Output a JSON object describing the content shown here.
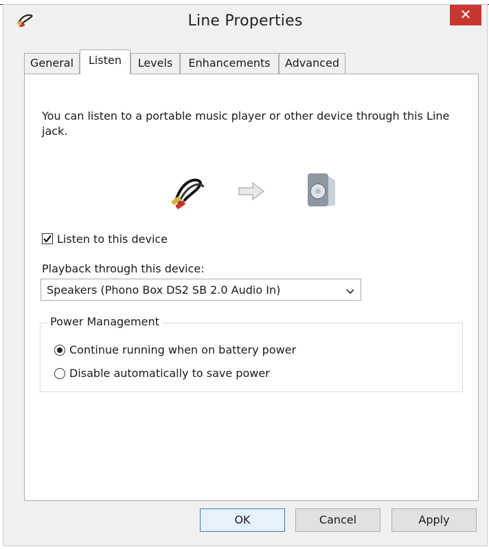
{
  "window": {
    "title": "Line Properties",
    "close_glyph": "✕",
    "icon": "line-in-cable-icon"
  },
  "tabs": [
    {
      "label": "General",
      "active": false
    },
    {
      "label": "Listen",
      "active": true
    },
    {
      "label": "Levels",
      "active": false
    },
    {
      "label": "Enhancements",
      "active": false
    },
    {
      "label": "Advanced",
      "active": false
    }
  ],
  "listen": {
    "description": "You can listen to a portable music player or other device through this Line jack.",
    "illustration": [
      "line-in-cable-icon",
      "arrow-right-icon",
      "speaker-icon"
    ],
    "checkbox_label": "Listen to this device",
    "checkbox_checked": true,
    "playback_label": "Playback through this device:",
    "playback_value": "Speakers (Phono Box DS2 SB 2.0 Audio In)"
  },
  "power": {
    "legend": "Power Management",
    "options": [
      {
        "label": "Continue running when on battery power",
        "selected": true
      },
      {
        "label": "Disable automatically to save power",
        "selected": false
      }
    ]
  },
  "buttons": {
    "ok": "OK",
    "cancel": "Cancel",
    "apply": "Apply"
  },
  "colors": {
    "close_red": "#c7372f",
    "window_bg": "#f0f0f0",
    "ok_border": "#3c7fb1"
  }
}
